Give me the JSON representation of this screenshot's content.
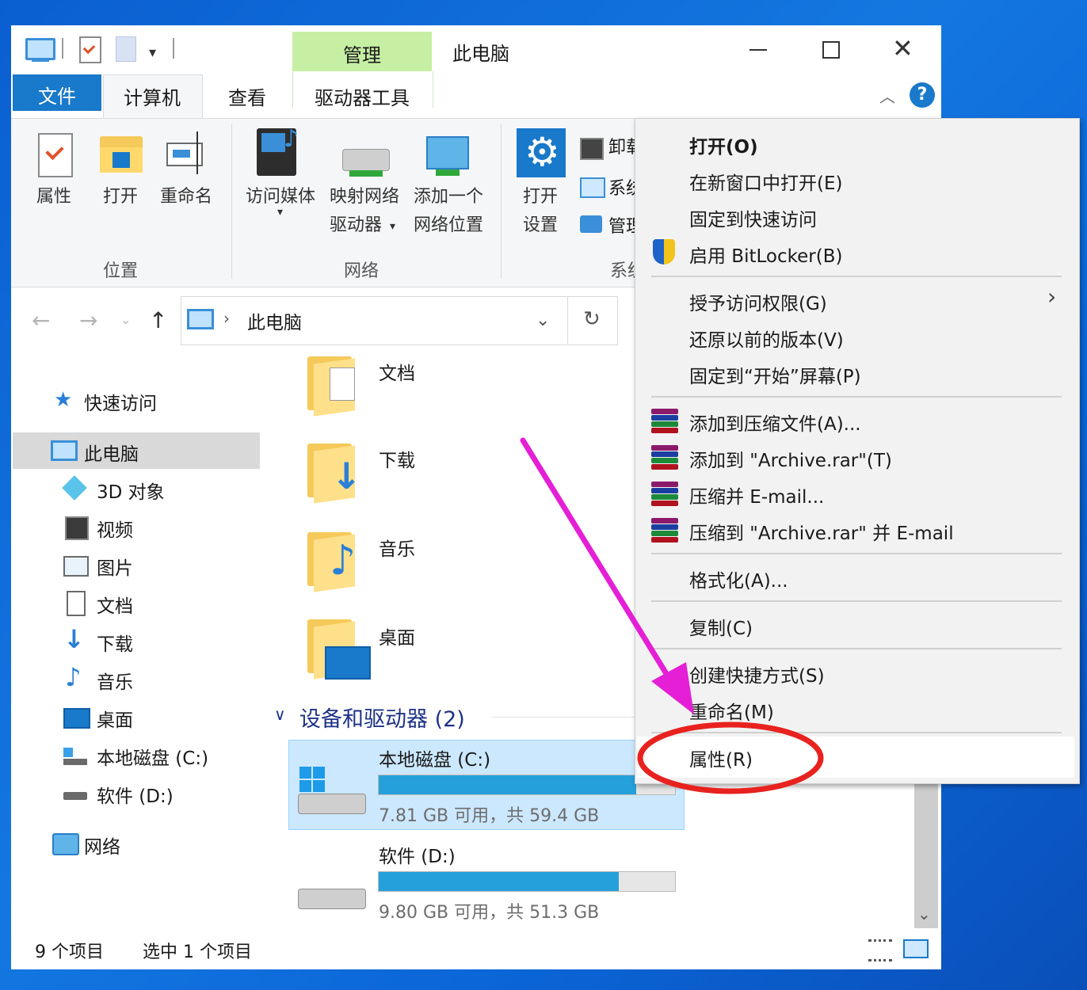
{
  "window": {
    "title": "此电脑",
    "manage_tab": "管理",
    "tabs": [
      "文件",
      "计算机",
      "查看",
      "驱动器工具"
    ],
    "accent": "#1979ca",
    "manage_color": "#c6efa3"
  },
  "ribbon": {
    "location": {
      "label": "位置",
      "items": [
        "属性",
        "打开",
        "重命名"
      ]
    },
    "network": {
      "label": "网络",
      "items": [
        "访问媒体",
        "映射网络",
        "驱动器",
        "添加一个",
        "网络位置"
      ]
    },
    "system": {
      "label": "系统",
      "items": [
        "打开",
        "设置",
        "卸载",
        "系统",
        "管理"
      ]
    }
  },
  "address": {
    "path": "此电脑"
  },
  "nav": {
    "quick_access": "快速访问",
    "this_pc": "此电脑",
    "items": [
      "3D 对象",
      "视频",
      "图片",
      "文档",
      "下载",
      "音乐",
      "桌面",
      "本地磁盘 (C:)",
      "软件 (D:)"
    ],
    "network": "网络"
  },
  "content": {
    "folders": [
      "文档",
      "下载",
      "音乐",
      "桌面"
    ],
    "devices_header": "设备和驱动器 (2)",
    "drives": [
      {
        "name": "本地磁盘 (C:)",
        "info": "7.81 GB 可用，共 59.4 GB",
        "used_fraction": 0.87
      },
      {
        "name": "软件 (D:)",
        "info": "9.80 GB 可用，共 51.3 GB",
        "used_fraction": 0.81
      }
    ]
  },
  "status": {
    "count": "9 个项目",
    "selected": "选中 1 个项目"
  },
  "context_menu": {
    "items": [
      "打开(O)",
      "在新窗口中打开(E)",
      "固定到快速访问",
      "启用 BitLocker(B)",
      "授予访问权限(G)",
      "还原以前的版本(V)",
      "固定到“开始”屏幕(P)",
      "添加到压缩文件(A)...",
      "添加到 \"Archive.rar\"(T)",
      "压缩并 E-mail...",
      "压缩到 \"Archive.rar\" 并 E-mail",
      "格式化(A)...",
      "复制(C)",
      "创建快捷方式(S)",
      "重命名(M)",
      "属性(R)"
    ]
  },
  "annotation": {
    "arrow_color": "#e51fd6",
    "circle_color": "#e8221f"
  }
}
